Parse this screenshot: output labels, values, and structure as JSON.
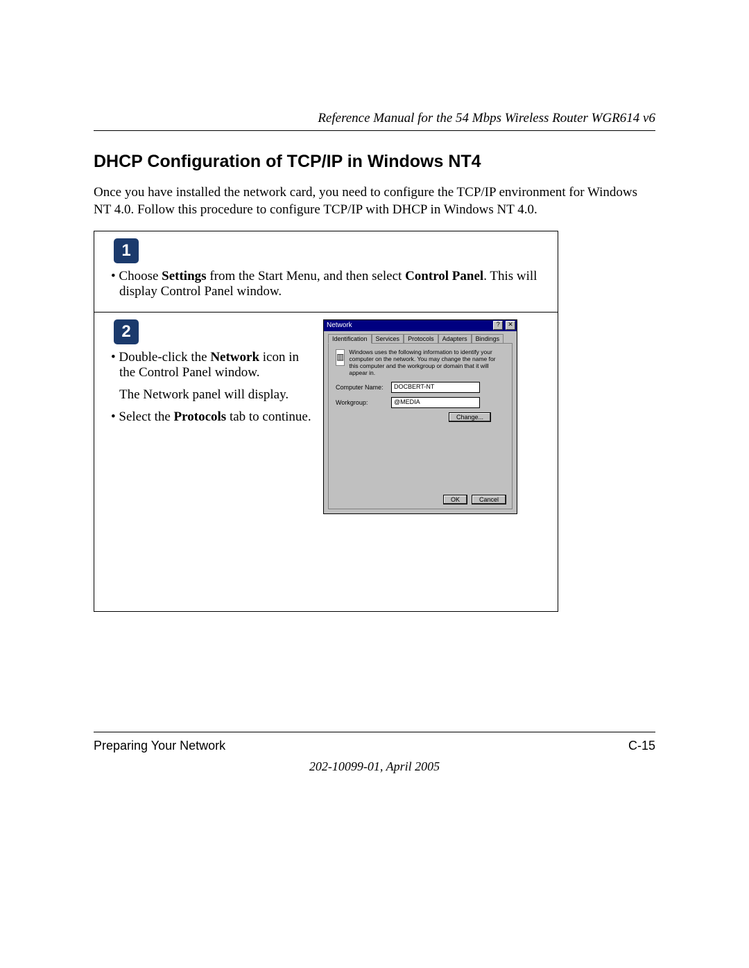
{
  "header": {
    "running": "Reference Manual for the 54 Mbps Wireless Router WGR614 v6"
  },
  "section": {
    "title": "DHCP Configuration of TCP/IP in Windows NT4"
  },
  "intro": "Once you have installed the network card, you need to configure the TCP/IP environment for Windows NT 4.0. Follow this procedure to configure TCP/IP with DHCP in Windows NT 4.0.",
  "steps": {
    "one": {
      "num": "1",
      "bullet_prefix": "• Choose ",
      "bold1": "Settings",
      "mid": " from the Start Menu, and then select ",
      "bold2": "Control Panel",
      "suffix": ". This will display Control Panel window."
    },
    "two": {
      "num": "2",
      "b1_prefix": "• Double-click the ",
      "b1_bold": "Network",
      "b1_suffix": " icon in the Control Panel window.",
      "line2": "The Network panel will display.",
      "b2_prefix": "• Select the ",
      "b2_bold": "Protocols",
      "b2_suffix": " tab to continue."
    }
  },
  "dialog": {
    "title": "Network",
    "help": "?",
    "close": "✕",
    "tabs": [
      "Identification",
      "Services",
      "Protocols",
      "Adapters",
      "Bindings"
    ],
    "info": "Windows uses the following information to identify your computer on the network.  You may change the name for this computer and the workgroup or domain that it will appear in.",
    "computer_label": "Computer Name:",
    "computer_value": "DOCBERT-NT",
    "workgroup_label": "Workgroup:",
    "workgroup_value": "@MEDIA",
    "change": "Change...",
    "ok": "OK",
    "cancel": "Cancel"
  },
  "footer": {
    "left": "Preparing Your Network",
    "right": "C-15",
    "docid": "202-10099-01, April 2005"
  }
}
